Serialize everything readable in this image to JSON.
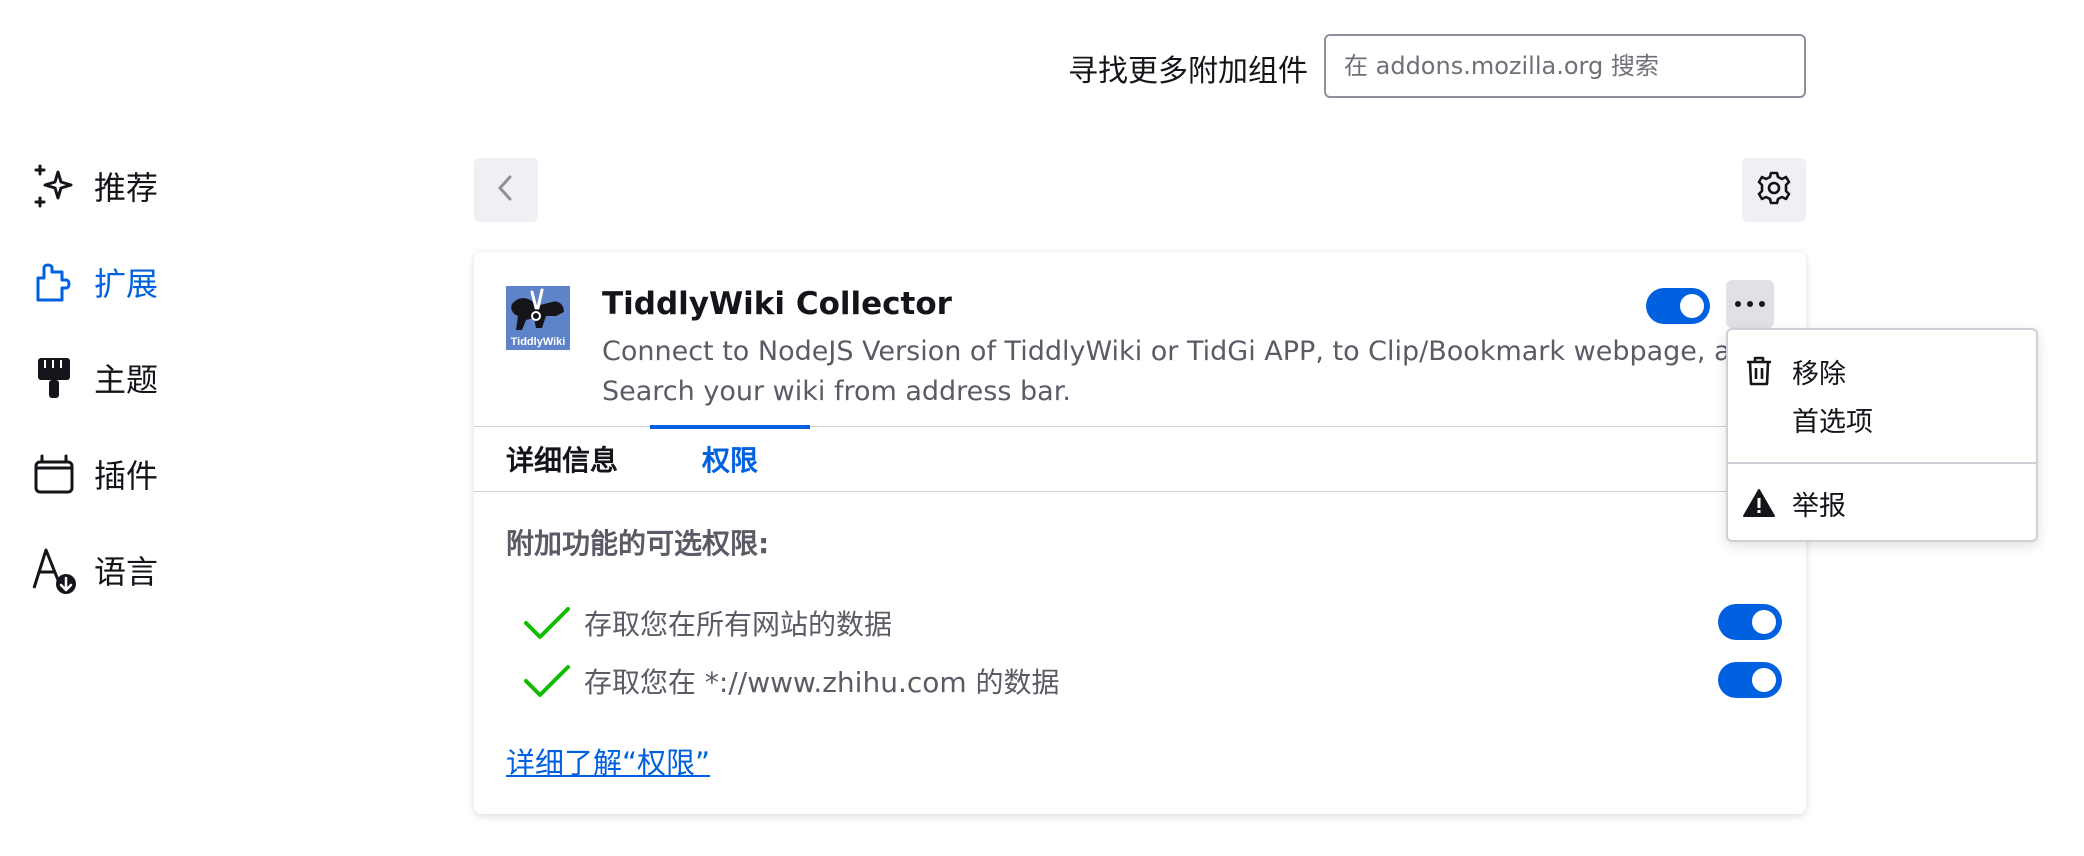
{
  "header": {
    "find_more_label": "寻找更多附加组件",
    "search_placeholder": "在 addons.mozilla.org 搜索"
  },
  "sidebar": {
    "items": [
      {
        "label": "推荐",
        "icon": "sparkle-icon"
      },
      {
        "label": "扩展",
        "icon": "puzzle-icon",
        "active": true
      },
      {
        "label": "主题",
        "icon": "paintbrush-icon"
      },
      {
        "label": "插件",
        "icon": "plugin-icon"
      },
      {
        "label": "语言",
        "icon": "language-icon"
      }
    ]
  },
  "addon": {
    "name": "TiddlyWiki Collector",
    "icon_brand": "TiddlyWiki",
    "description_line1": "Connect to NodeJS Version of TiddlyWiki or TidGi APP, to Clip/Bookmark webpage, and",
    "description_line2": "Search your wiki from address bar.",
    "enabled": true,
    "tabs": [
      "详细信息",
      "权限"
    ],
    "active_tab": "权限",
    "optional_permissions_title": "附加功能的可选权限:",
    "permissions": [
      {
        "text": "存取您在所有网站的数据",
        "granted": true
      },
      {
        "text": "存取您在 *://www.zhihu.com 的数据",
        "granted": true
      }
    ],
    "learn_more_link": "详细了解“权限”"
  },
  "menu": {
    "items": [
      {
        "label": "移除",
        "icon": "trash-icon"
      },
      {
        "label": "首选项",
        "icon": ""
      },
      {
        "label": "举报",
        "icon": "warning-icon"
      }
    ]
  },
  "colors": {
    "accent": "#0061e0",
    "check": "#2ac3a2"
  }
}
